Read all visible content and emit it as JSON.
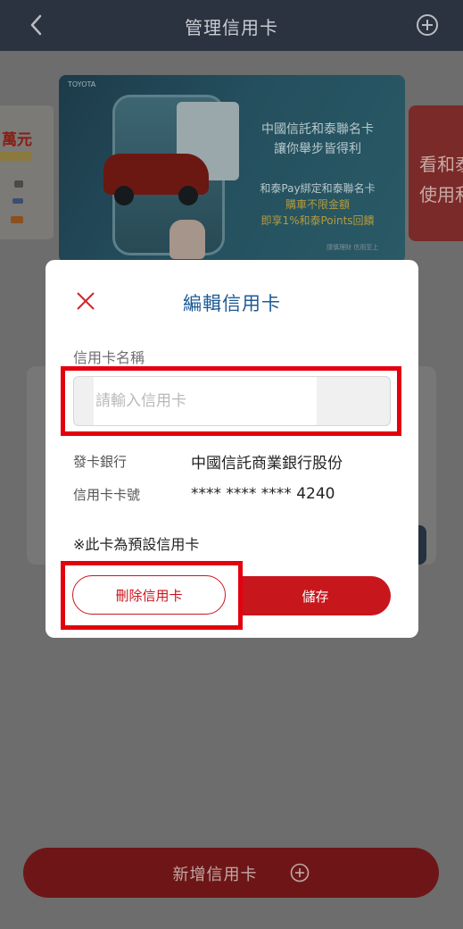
{
  "header": {
    "title": "管理信用卡"
  },
  "carousel": {
    "left_card_text": "萬元",
    "banner": {
      "brand": "TOYOTA",
      "line1": "中國信託和泰聯名卡",
      "line2": "讓你舉步皆得利",
      "line3": "和泰Pay綁定和泰聯名卡",
      "line4": "購車不限金額",
      "line5": "即享1%和泰Points回饋",
      "fine_print": "謹慎理財 信用至上"
    },
    "right_card_line1": "看和泰",
    "right_card_line2": "使用和"
  },
  "modal": {
    "title": "編輯信用卡",
    "name_label": "信用卡名稱",
    "name_placeholder": "請輸入信用卡",
    "name_value": "",
    "bank_label": "發卡銀行",
    "bank_value": "中國信託商業銀行股份",
    "number_label": "信用卡卡號",
    "number_value": "**** **** **** 4240",
    "default_note": "※此卡為預設信用卡",
    "delete_label": "刪除信用卡",
    "save_label": "儲存"
  },
  "footer": {
    "add_card_label": "新增信用卡"
  },
  "colors": {
    "header_bg": "#2b3340",
    "primary_red": "#c8161d",
    "title_blue": "#1e5a96",
    "highlight_red": "#e3000f"
  },
  "icons": {
    "back": "chevron-left-icon",
    "add": "plus-circle-icon",
    "close": "close-icon"
  }
}
